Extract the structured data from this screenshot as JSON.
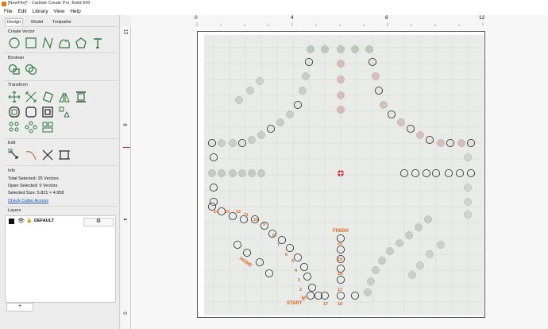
{
  "window": {
    "title": "[NewFile]* - Carbide Create Pro, Build 843"
  },
  "menu": [
    "File",
    "Edit",
    "Library",
    "View",
    "Help"
  ],
  "tabs": [
    "Design",
    "Model",
    "Toolpaths"
  ],
  "sections": {
    "create_vector": "Create Vector",
    "boolean": "Boolean",
    "transform": "Transform",
    "edit": "Edit",
    "info": "Info",
    "layers": "Layers"
  },
  "info": {
    "total_selected": "Total Selected:   25 Vectors",
    "open_selected": "Open Selected:    0 Vectors",
    "selected_size": "Selected Size:    5.821 × 4.958",
    "check_link": "Check Cutter Access"
  },
  "layers": {
    "name": "DEFAULT",
    "add_label": "+"
  },
  "ruler": {
    "top": [
      "0",
      "4",
      "8",
      "12"
    ],
    "left": [
      "12",
      "8",
      "4",
      "0"
    ]
  },
  "board_labels": {
    "finish": "FINISH",
    "home": "HOME",
    "start": "START",
    "left_track": [
      "14",
      "13",
      "12",
      "11",
      "10",
      "9",
      "8",
      "7",
      "6",
      "5",
      "4",
      "3",
      "2",
      "1"
    ],
    "bottom_track": [
      "14",
      "17",
      "18"
    ],
    "right_track": [
      "20",
      "19",
      "18",
      "17"
    ]
  },
  "colors": {
    "accent": "#e0661a",
    "vector": "#2a7a3a",
    "selected": "#222222"
  }
}
